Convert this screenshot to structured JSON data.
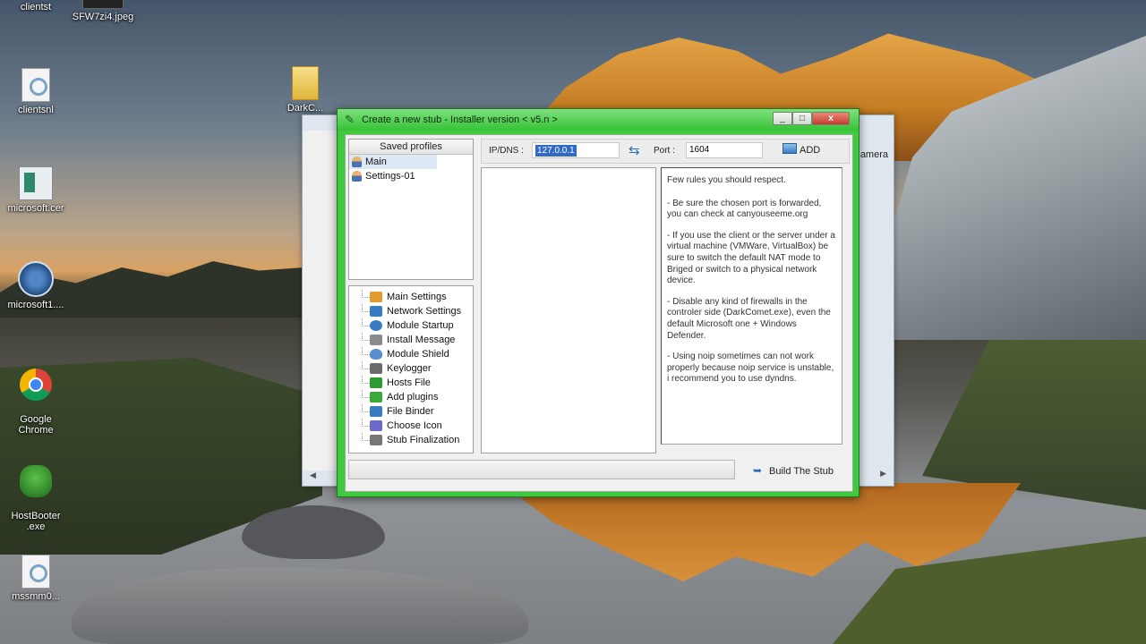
{
  "desktop": {
    "icons": [
      {
        "label": "clientst",
        "icon": "shield-icon"
      },
      {
        "label": "SFW7zi4.jpeg",
        "icon": "image-thumbnail-icon"
      },
      {
        "label": "clientsnl",
        "icon": "document-gear-icon"
      },
      {
        "label": "microsoft.cer",
        "icon": "image-file-icon"
      },
      {
        "label": "microsoft1....",
        "icon": "app-circle-icon"
      },
      {
        "label": "Google\nChrome",
        "icon": "chrome-icon"
      },
      {
        "label": "HostBooter\n.exe",
        "icon": "hostbooter-icon"
      },
      {
        "label": "mssmm0...",
        "icon": "document-gear-icon"
      },
      {
        "label": "DarkC...",
        "icon": "folder-icon"
      }
    ]
  },
  "background_window": {
    "partial_text": "amera"
  },
  "dialog": {
    "title": "Create a new stub - Installer version < v5.n >",
    "title_buttons": {
      "minimize": "_",
      "maximize": "□",
      "close": "x"
    },
    "profiles": {
      "header": "Saved profiles",
      "items": [
        {
          "label": "Main",
          "selected": true
        },
        {
          "label": "Settings-01",
          "selected": false
        }
      ]
    },
    "settings_tree": [
      {
        "label": "Main Settings",
        "icon": "home-icon",
        "color": "#e39a2f"
      },
      {
        "label": "Network Settings",
        "icon": "network-icon",
        "color": "#3a7cc4"
      },
      {
        "label": "Module Startup",
        "icon": "startup-icon",
        "color": "#3a7cc4"
      },
      {
        "label": "Install Message",
        "icon": "message-icon",
        "color": "#8a8a8a"
      },
      {
        "label": "Module Shield",
        "icon": "shield-icon",
        "color": "#5a8fd0"
      },
      {
        "label": "Keylogger",
        "icon": "keyboard-icon",
        "color": "#6a6a6a"
      },
      {
        "label": "Hosts File",
        "icon": "hosts-icon",
        "color": "#2f9a2f"
      },
      {
        "label": "Add plugins",
        "icon": "plugin-icon",
        "color": "#3aa83a"
      },
      {
        "label": "File Binder",
        "icon": "binder-icon",
        "color": "#3a7cc4"
      },
      {
        "label": "Choose Icon",
        "icon": "icon-picker-icon",
        "color": "#6c6cc8"
      },
      {
        "label": "Stub Finalization",
        "icon": "finalize-icon",
        "color": "#777777"
      }
    ],
    "connection": {
      "ip_label": "IP/DNS :",
      "ip_value": "127.0.0.1",
      "port_label": "Port :",
      "port_value": "1604",
      "add_label": "ADD"
    },
    "rules": [
      "Few rules you should respect.",
      "- Be sure the chosen port is forwarded, you can check at canyouseeme.org",
      "- If you use the client or the server under a virtual machine (VMWare, VirtualBox) be sure to switch the default NAT mode to Briged or switch to a physical network device.",
      "- Disable any kind of firewalls in the controler side (DarkComet.exe), even the default Microsoft one + Windows Defender.",
      "- Using noip sometimes can not work properly because noip service is unstable, i recommend you to use dyndns."
    ],
    "build_label": "Build The Stub"
  }
}
